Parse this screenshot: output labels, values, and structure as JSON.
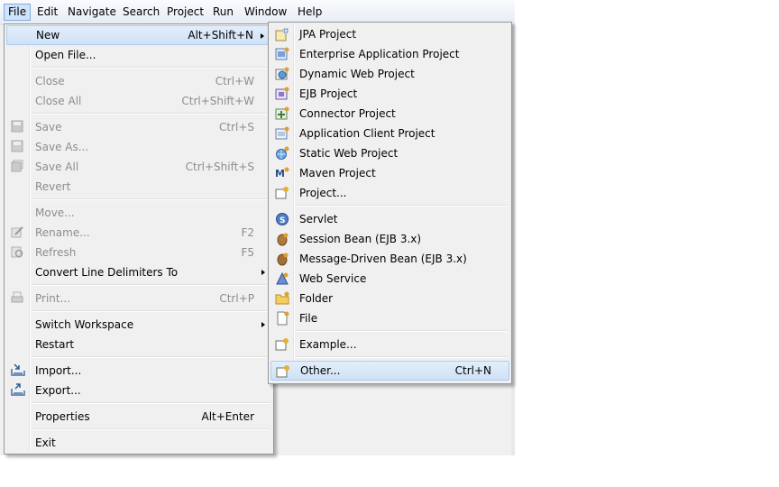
{
  "menubar": {
    "items": [
      "File",
      "Edit",
      "Navigate",
      "Search",
      "Project",
      "Run",
      "Window",
      "Help"
    ]
  },
  "file_menu": {
    "new": {
      "label": "New",
      "shortcut": "Alt+Shift+N"
    },
    "open_file": {
      "label": "Open File..."
    },
    "close": {
      "label": "Close",
      "shortcut": "Ctrl+W"
    },
    "close_all": {
      "label": "Close All",
      "shortcut": "Ctrl+Shift+W"
    },
    "save": {
      "label": "Save",
      "shortcut": "Ctrl+S"
    },
    "save_as": {
      "label": "Save As..."
    },
    "save_all": {
      "label": "Save All",
      "shortcut": "Ctrl+Shift+S"
    },
    "revert": {
      "label": "Revert"
    },
    "move": {
      "label": "Move..."
    },
    "rename": {
      "label": "Rename...",
      "shortcut": "F2"
    },
    "refresh": {
      "label": "Refresh",
      "shortcut": "F5"
    },
    "convert": {
      "label": "Convert Line Delimiters To"
    },
    "print": {
      "label": "Print...",
      "shortcut": "Ctrl+P"
    },
    "switch_workspace": {
      "label": "Switch Workspace"
    },
    "restart": {
      "label": "Restart"
    },
    "import": {
      "label": "Import..."
    },
    "export": {
      "label": "Export..."
    },
    "properties": {
      "label": "Properties",
      "shortcut": "Alt+Enter"
    },
    "exit": {
      "label": "Exit"
    }
  },
  "new_submenu": {
    "jpa_project": {
      "label": "JPA Project"
    },
    "enterprise_app": {
      "label": "Enterprise Application Project"
    },
    "dynamic_web": {
      "label": "Dynamic Web Project"
    },
    "ejb_project": {
      "label": "EJB Project"
    },
    "connector_project": {
      "label": "Connector Project"
    },
    "app_client": {
      "label": "Application Client Project"
    },
    "static_web": {
      "label": "Static Web Project"
    },
    "maven_project": {
      "label": "Maven Project"
    },
    "project": {
      "label": "Project..."
    },
    "servlet": {
      "label": "Servlet"
    },
    "session_bean": {
      "label": "Session Bean (EJB 3.x)"
    },
    "mdb": {
      "label": "Message-Driven Bean (EJB 3.x)"
    },
    "web_service": {
      "label": "Web Service"
    },
    "folder": {
      "label": "Folder"
    },
    "file": {
      "label": "File"
    },
    "example": {
      "label": "Example..."
    },
    "other": {
      "label": "Other...",
      "shortcut": "Ctrl+N"
    }
  }
}
